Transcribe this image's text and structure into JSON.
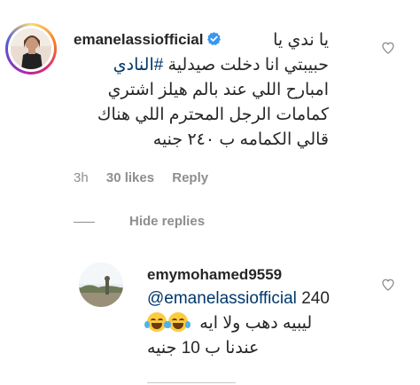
{
  "comment": {
    "username": "emanelassiofficial",
    "verified": true,
    "lines": [
      "يا ندي يا",
      "حبيبتي انا دخلت صيدلية",
      "#النادي",
      "امبارح اللي عند بالم هيلز اشتري",
      "كمامات الرجل المحترم اللي هناك",
      "قالي الكمامه ب ٢٤٠ جنيه"
    ],
    "time": "3h",
    "likes": "30 likes",
    "reply": "Reply",
    "hide_replies": "Hide replies"
  },
  "reply_comment": {
    "username": "emymohamed9559",
    "mention": "@emanelassiofficial",
    "mention_suffix": "240",
    "line2": "ليبيه دهب ولا ايه",
    "line3": "عندنا ب 10 جنيه"
  },
  "icons": {
    "like": "heart-outline-icon",
    "verified": "verified-badge-icon",
    "emoji": "face-with-tears-of-joy-icon"
  },
  "colors": {
    "text": "#262626",
    "secondary": "#8e8e8e",
    "link": "#00376b",
    "verified": "#3897f0"
  }
}
